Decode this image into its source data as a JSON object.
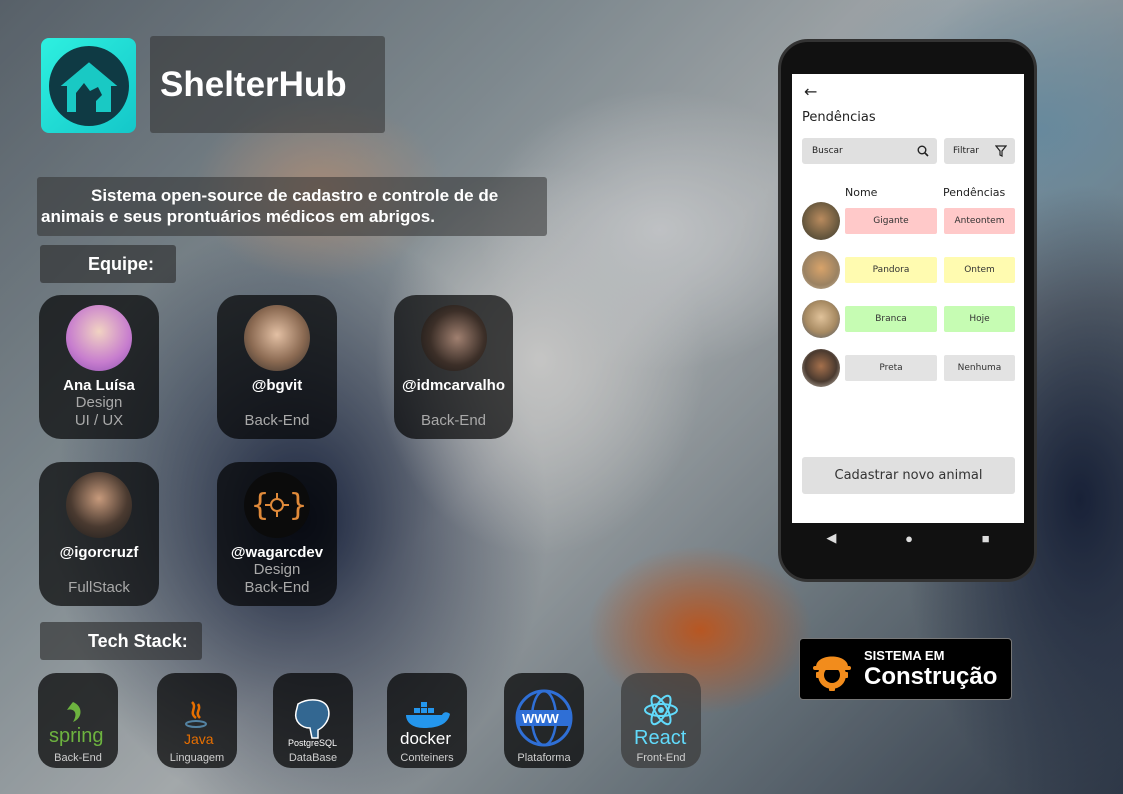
{
  "app": {
    "title": "ShelterHub",
    "description": "Sistema open-source de cadastro e controle de de animais e seus prontuários médicos em abrigos."
  },
  "team": {
    "heading": "Equipe:",
    "members": [
      {
        "handle": "Ana Luísa",
        "role1": "Design",
        "role2": "UI / UX"
      },
      {
        "handle": "@bgvit",
        "role1": "",
        "role2": "Back-End"
      },
      {
        "handle": "@idmcarvalho",
        "role1": "",
        "role2": "Back-End"
      },
      {
        "handle": "@igorcruzf",
        "role1": "",
        "role2": "FullStack"
      },
      {
        "handle": "@wagarcdev",
        "role1": "Design",
        "role2": "Back-End"
      }
    ]
  },
  "stack": {
    "heading": "Tech Stack:",
    "items": [
      {
        "name": "spring",
        "label": "Back-End"
      },
      {
        "name": "Java",
        "label": "Linguagem"
      },
      {
        "name": "PostgreSQL",
        "label": "DataBase"
      },
      {
        "name": "docker",
        "label": "Conteiners"
      },
      {
        "name": "WWW",
        "label": "Plataforma"
      },
      {
        "name": "React",
        "label": "Front-End"
      }
    ]
  },
  "phone": {
    "title": "Pendências",
    "search_placeholder": "Buscar",
    "filter_label": "Filtrar",
    "col_name": "Nome",
    "col_pend": "Pendências",
    "rows": [
      {
        "name": "Gigante",
        "pend": "Anteontem",
        "color": "#ffc9c9"
      },
      {
        "name": "Pandora",
        "pend": "Ontem",
        "color": "#fffbb0"
      },
      {
        "name": "Branca",
        "pend": "Hoje",
        "color": "#c6fcb3"
      },
      {
        "name": "Preta",
        "pend": "Nenhuma",
        "color": "#e3e3e3"
      }
    ],
    "register_button": "Cadastrar novo animal"
  },
  "badge": {
    "line1": "SISTEMA EM",
    "line2": "Construção"
  },
  "colors": {
    "logo": "#1ed6d0"
  }
}
